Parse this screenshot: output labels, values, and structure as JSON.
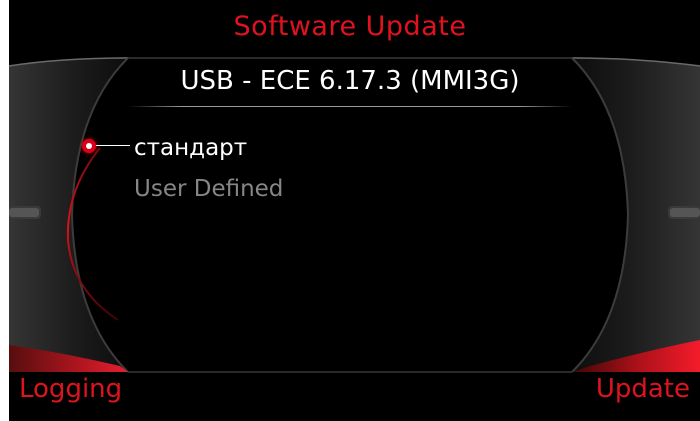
{
  "screen": {
    "title": "Software Update",
    "accent_color": "#e0121f"
  },
  "source": {
    "label": "USB - ECE 6.17.3 (MMI3G)"
  },
  "options": [
    {
      "label": "стандарт",
      "selected": true
    },
    {
      "label": "User Defined",
      "selected": false
    }
  ],
  "softkeys": {
    "left": "Logging",
    "right": "Update"
  },
  "icons": {
    "selected_radio": "radio-selected-icon",
    "frame": "bezel-frame"
  }
}
